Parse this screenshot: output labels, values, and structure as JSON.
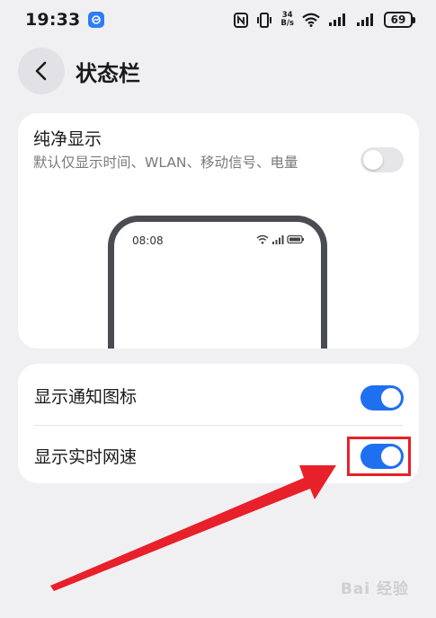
{
  "status_bar": {
    "time": "19:33",
    "net_speed_value": "34",
    "net_speed_unit": "B/s",
    "battery": "69"
  },
  "header": {
    "title": "状态栏"
  },
  "clean_display": {
    "title": "纯净显示",
    "description": "默认仅显示时间、WLAN、移动信号、电量",
    "enabled": false,
    "preview_time": "08:08"
  },
  "settings": [
    {
      "label": "显示通知图标",
      "enabled": true
    },
    {
      "label": "显示实时网速",
      "enabled": true
    }
  ],
  "watermark": "Bai 经验",
  "colors": {
    "accent": "#1f6ff1",
    "toggle_off": "#e6e6e8",
    "annotation_red": "#e8202a",
    "background": "#f0f0f3"
  }
}
